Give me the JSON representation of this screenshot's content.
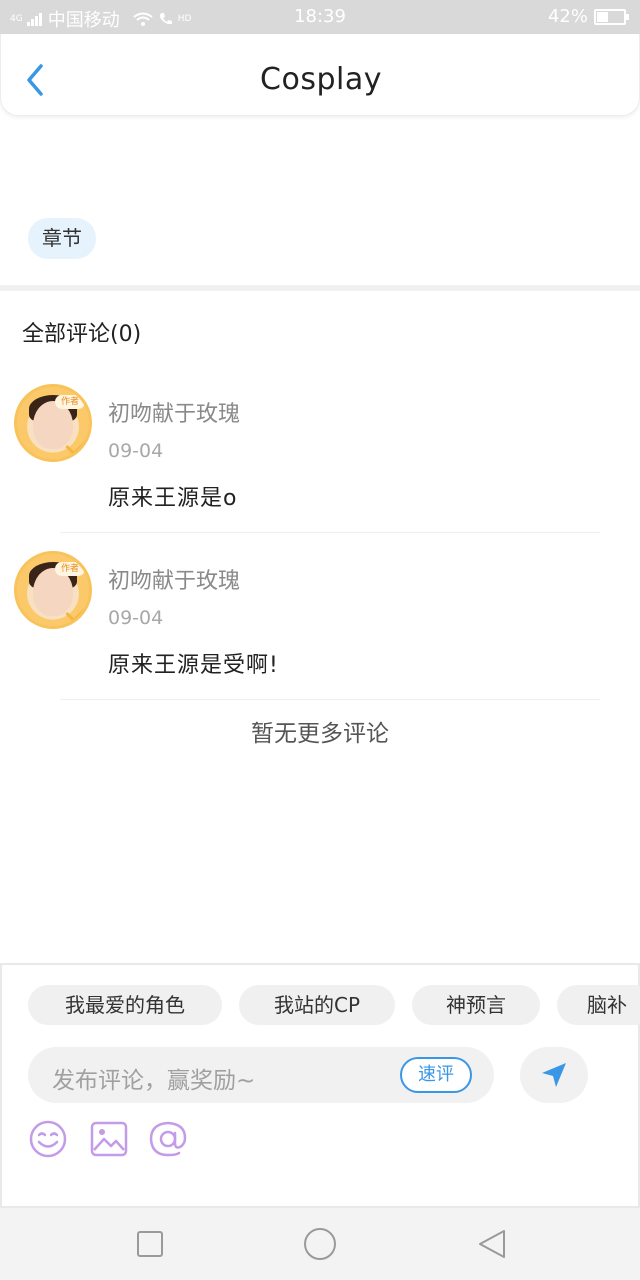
{
  "status_bar": {
    "network": "4G",
    "carrier": "中国移动",
    "hd": "HD",
    "time": "18:39",
    "battery_text": "42%",
    "battery_level": 0.42
  },
  "header": {
    "title": "Cosplay",
    "back_icon": "chevron-left-icon"
  },
  "tag": {
    "label": "章节"
  },
  "comments_section": {
    "title": "全部评论(0)",
    "items": [
      {
        "user": "初吻献于玫瑰",
        "date": "09-04",
        "text": "原来王源是o",
        "badge": "作者"
      },
      {
        "user": "初吻献于玫瑰",
        "date": "09-04",
        "text": "原来王源是受啊!",
        "badge": "作者"
      }
    ],
    "no_more": "暂无更多评论"
  },
  "composer": {
    "chips": [
      "我最爱的角色",
      "我站的CP",
      "神预言",
      "脑补"
    ],
    "placeholder": "发布评论，赢奖励~",
    "quick_label": "速评",
    "send_icon": "send-icon",
    "tools": [
      "emoji-icon",
      "image-icon",
      "mention-icon"
    ]
  },
  "nav": [
    "square-icon",
    "circle-icon",
    "triangle-back-icon"
  ],
  "colors": {
    "accent": "#3a97e6",
    "tag_bg": "#e6f3fd",
    "avatar_ring": "#f7c35a"
  }
}
